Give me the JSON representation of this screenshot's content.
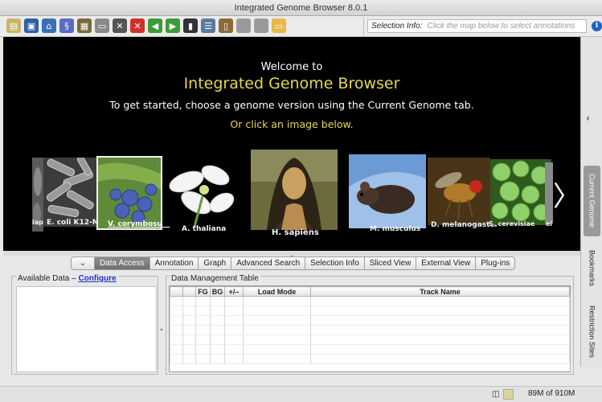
{
  "window": {
    "title": "Integrated Genome Browser 8.0.1"
  },
  "toolbar": {
    "buttons": [
      {
        "name": "open-file-icon",
        "glyph": "▤",
        "color": "#c9b56a"
      },
      {
        "name": "save-session-icon",
        "glyph": "▣",
        "color": "#2f5fa8"
      },
      {
        "name": "home-icon",
        "glyph": "⌂",
        "color": "#3b6fb3"
      },
      {
        "name": "dna-icon",
        "glyph": "§",
        "color": "#5a6bc0"
      },
      {
        "name": "image-export-icon",
        "glyph": "▦",
        "color": "#7a6a3a"
      },
      {
        "name": "print-icon",
        "glyph": "▭",
        "color": "#8a8a8a"
      },
      {
        "name": "tools-icon",
        "glyph": "✕",
        "color": "#555555"
      },
      {
        "name": "stop-icon",
        "glyph": "✕",
        "color": "#d0322a"
      },
      {
        "name": "back-icon",
        "glyph": "◀",
        "color": "#3d9a3a"
      },
      {
        "name": "forward-icon",
        "glyph": "▶",
        "color": "#3d9a3a"
      },
      {
        "name": "film-icon",
        "glyph": "▮",
        "color": "#333333"
      },
      {
        "name": "bookmark-icon",
        "glyph": "☰",
        "color": "#5a7aa0"
      },
      {
        "name": "notebook-icon",
        "glyph": "▯",
        "color": "#8b6a3a"
      },
      {
        "name": "gray-box-icon",
        "glyph": "",
        "color": "#9a9a9a"
      },
      {
        "name": "gray-box-2-icon",
        "glyph": "",
        "color": "#9a9a9a"
      },
      {
        "name": "comment-icon",
        "glyph": "▭",
        "color": "#e8b84a"
      }
    ]
  },
  "selection_info": {
    "label": "Selection Info:",
    "placeholder": "Click the map below to select annotations"
  },
  "welcome": {
    "line1": "Welcome to",
    "line2": "Integrated Genome Browser",
    "line3": "To get started, choose a genome version using the Current Genome tab.",
    "line4": "Or click an image below.",
    "colors": {
      "accent": "#e8d84a",
      "text": "#ffffff"
    }
  },
  "carousel": {
    "prev_glyph": "〈",
    "next_glyph": "〉",
    "species": [
      {
        "id": "ecoli-partial",
        "caption": "iapi"
      },
      {
        "id": "ecoli",
        "caption": "E. coli K12-MG"
      },
      {
        "id": "vcorymbosum",
        "caption": "V. corymbosum"
      },
      {
        "id": "athaliana",
        "caption": "A. thaliana"
      },
      {
        "id": "hsapiens",
        "caption": "H. sapiens"
      },
      {
        "id": "mmusculus",
        "caption": "M. musculus"
      },
      {
        "id": "dmelanogaster",
        "caption": "D. melanogaster"
      },
      {
        "id": "scerevisiae",
        "caption": "S. cerevisiae"
      },
      {
        "id": "partial-right",
        "caption": "ei"
      }
    ]
  },
  "right_tabs": [
    {
      "label": "Current Genome",
      "selected": true
    },
    {
      "label": "Bookmarks",
      "selected": false
    },
    {
      "label": "Restriction Sites",
      "selected": false
    }
  ],
  "bottom_tabs": [
    {
      "label": "Data Access",
      "selected": true
    },
    {
      "label": "Annotation",
      "selected": false
    },
    {
      "label": "Graph",
      "selected": false
    },
    {
      "label": "Advanced Search",
      "selected": false
    },
    {
      "label": "Selection Info",
      "selected": false
    },
    {
      "label": "Sliced View",
      "selected": false
    },
    {
      "label": "External View",
      "selected": false
    },
    {
      "label": "Plug-ins",
      "selected": false
    }
  ],
  "available_data": {
    "legend": "Available Data –",
    "configure_link": "Configure"
  },
  "data_table": {
    "legend": "Data Management Table",
    "columns": [
      "",
      "",
      "FG",
      "BG",
      "+/–",
      "Load Mode",
      "Track Name"
    ],
    "empty_rows": 7
  },
  "status": {
    "memory": "89M of 910M"
  }
}
